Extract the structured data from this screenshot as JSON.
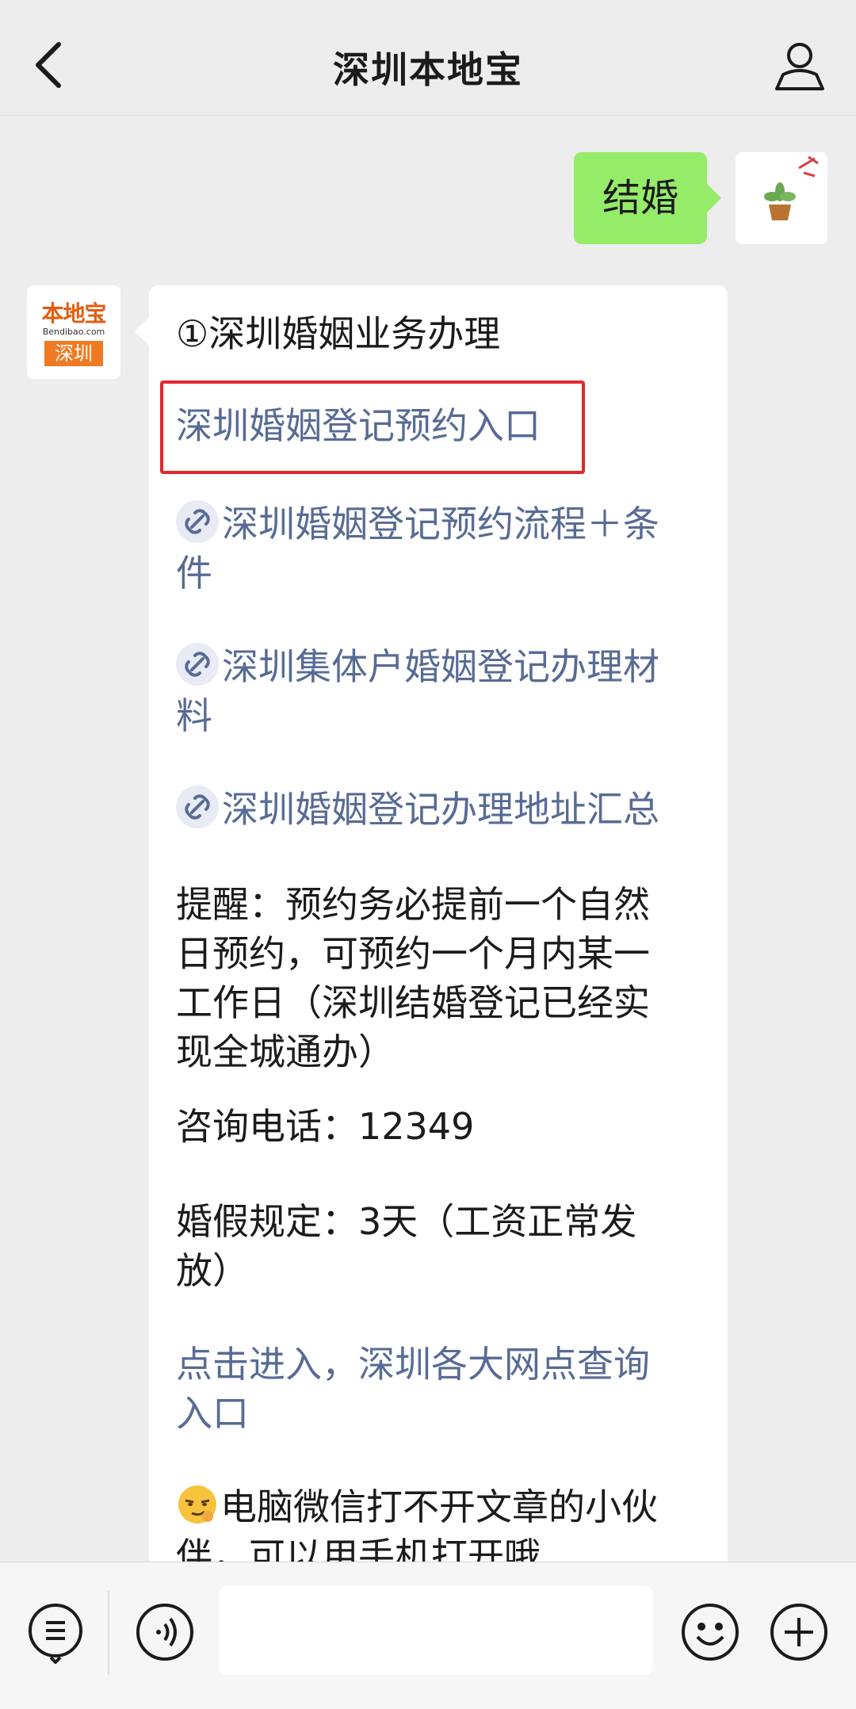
{
  "header": {
    "title": "深圳本地宝"
  },
  "user_message": {
    "text": "结婚"
  },
  "bot": {
    "avatar": {
      "logo_text": "本地宝",
      "logo_domain": "Bendibao.com",
      "logo_city": "深圳"
    },
    "section_title": "①深圳婚姻业务办理",
    "highlight_link": "深圳婚姻登记预约入口",
    "links": [
      {
        "line1": "深圳婚姻登记预约流程＋条",
        "line2": "件"
      },
      {
        "line1": "深圳集体户婚姻登记办理材",
        "line2": "料"
      },
      {
        "line1": "深圳婚姻登记办理地址汇总"
      }
    ],
    "reminder_lines": [
      "提醒：预约务必提前一个自然",
      "日预约，可预约一个月内某一",
      "工作日（深圳结婚登记已经实",
      "现全城通办）"
    ],
    "phone": "咨询电话：12349",
    "leave_lines": [
      "婚假规定：3天（工资正常发",
      "放）"
    ],
    "query_link_lines": [
      "点击进入，深圳各大网点查询",
      "入口"
    ],
    "pc_tip": "电脑微信打不开文章的小伙",
    "pc_tip_cut": "伴，可以用手机打开哦"
  },
  "bottom_bar": {
    "input_placeholder": ""
  },
  "colors": {
    "background": "#ededed",
    "user_bubble": "#95ec69",
    "link": "#576b95",
    "highlight_border": "#e4262a"
  },
  "icons": [
    "back-icon",
    "profile-icon",
    "link-icon",
    "menu-icon",
    "voice-icon",
    "emoji-icon",
    "plus-icon"
  ]
}
